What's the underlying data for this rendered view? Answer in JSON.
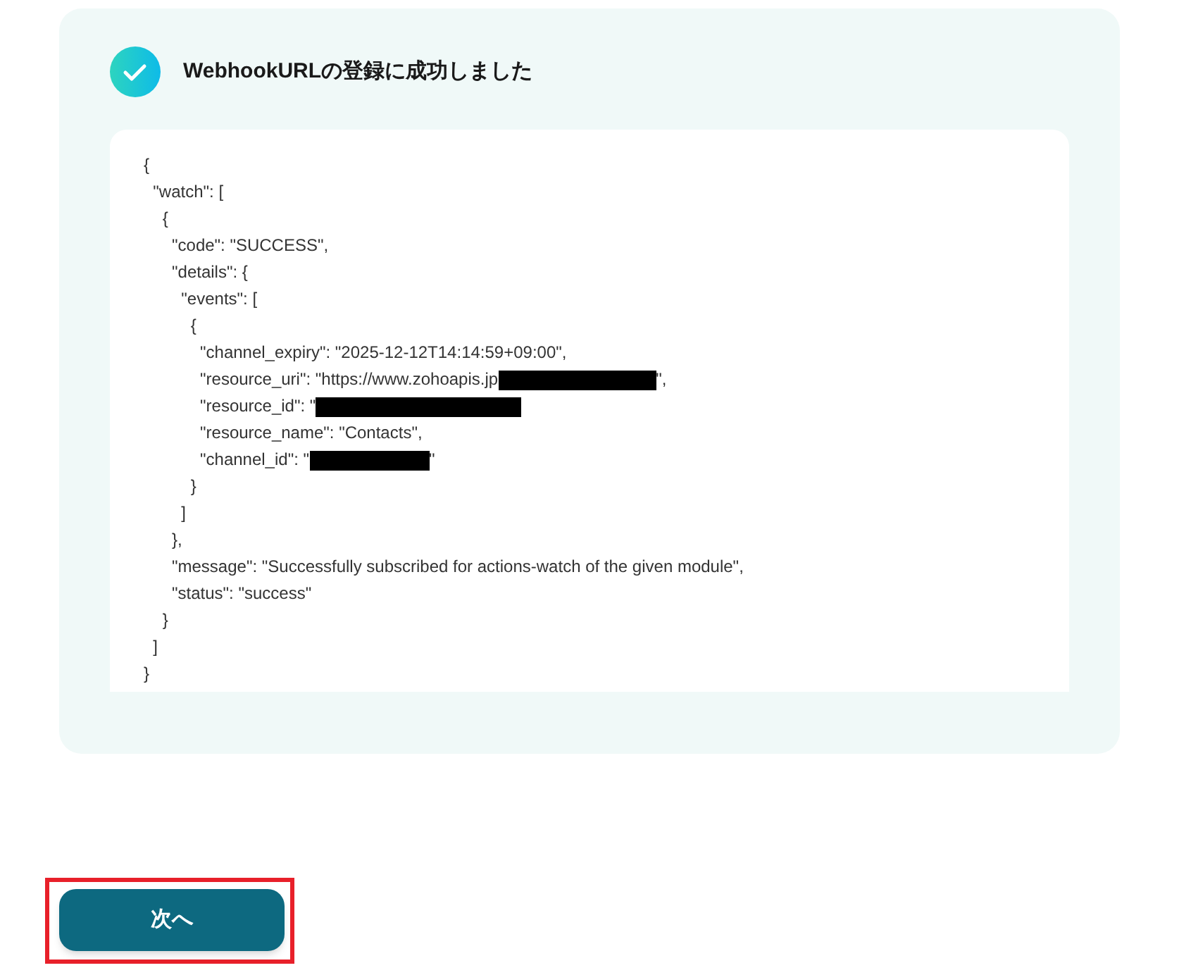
{
  "result": {
    "succeeded": true,
    "title": "WebhookURLの登録に成功しました",
    "code_lines": [
      {
        "parts": [
          {
            "kind": "text",
            "text": "{"
          }
        ]
      },
      {
        "parts": [
          {
            "kind": "text",
            "text": "  \"watch\": ["
          }
        ]
      },
      {
        "parts": [
          {
            "kind": "text",
            "text": "    {"
          }
        ]
      },
      {
        "parts": [
          {
            "kind": "text",
            "text": "      \"code\": \"SUCCESS\","
          }
        ]
      },
      {
        "parts": [
          {
            "kind": "text",
            "text": "      \"details\": {"
          }
        ]
      },
      {
        "parts": [
          {
            "kind": "text",
            "text": "        \"events\": ["
          }
        ]
      },
      {
        "parts": [
          {
            "kind": "text",
            "text": "          {"
          }
        ]
      },
      {
        "parts": [
          {
            "kind": "text",
            "text": "            \"channel_expiry\": \"2025-12-12T14:14:59+09:00\","
          }
        ]
      },
      {
        "parts": [
          {
            "kind": "text",
            "text": "            \"resource_uri\": \"https://www.zohoapis.jp"
          },
          {
            "kind": "medium_redaction"
          },
          {
            "kind": "text",
            "text": "\","
          }
        ]
      },
      {
        "parts": [
          {
            "kind": "text",
            "text": "            \"resource_id\": \""
          },
          {
            "kind": "long_redaction"
          }
        ]
      },
      {
        "parts": [
          {
            "kind": "text",
            "text": "            \"resource_name\": \"Contacts\","
          }
        ]
      },
      {
        "parts": [
          {
            "kind": "text",
            "text": "            \"channel_id\": \""
          },
          {
            "kind": "short_redaction"
          },
          {
            "kind": "text",
            "text": "\""
          }
        ]
      },
      {
        "parts": [
          {
            "kind": "text",
            "text": "          }"
          }
        ]
      },
      {
        "parts": [
          {
            "kind": "text",
            "text": "        ]"
          }
        ]
      },
      {
        "parts": [
          {
            "kind": "text",
            "text": "      },"
          }
        ]
      },
      {
        "parts": [
          {
            "kind": "text",
            "text": "      \"message\": \"Successfully subscribed for actions-watch of the given module\","
          }
        ]
      },
      {
        "parts": [
          {
            "kind": "text",
            "text": "      \"status\": \"success\""
          }
        ]
      },
      {
        "parts": [
          {
            "kind": "text",
            "text": "    }"
          }
        ]
      },
      {
        "parts": [
          {
            "kind": "text",
            "text": "  ]"
          }
        ]
      },
      {
        "parts": [
          {
            "kind": "text",
            "text": "}"
          }
        ]
      }
    ]
  },
  "next_button": {
    "label": "次へ",
    "highlighted": true
  }
}
